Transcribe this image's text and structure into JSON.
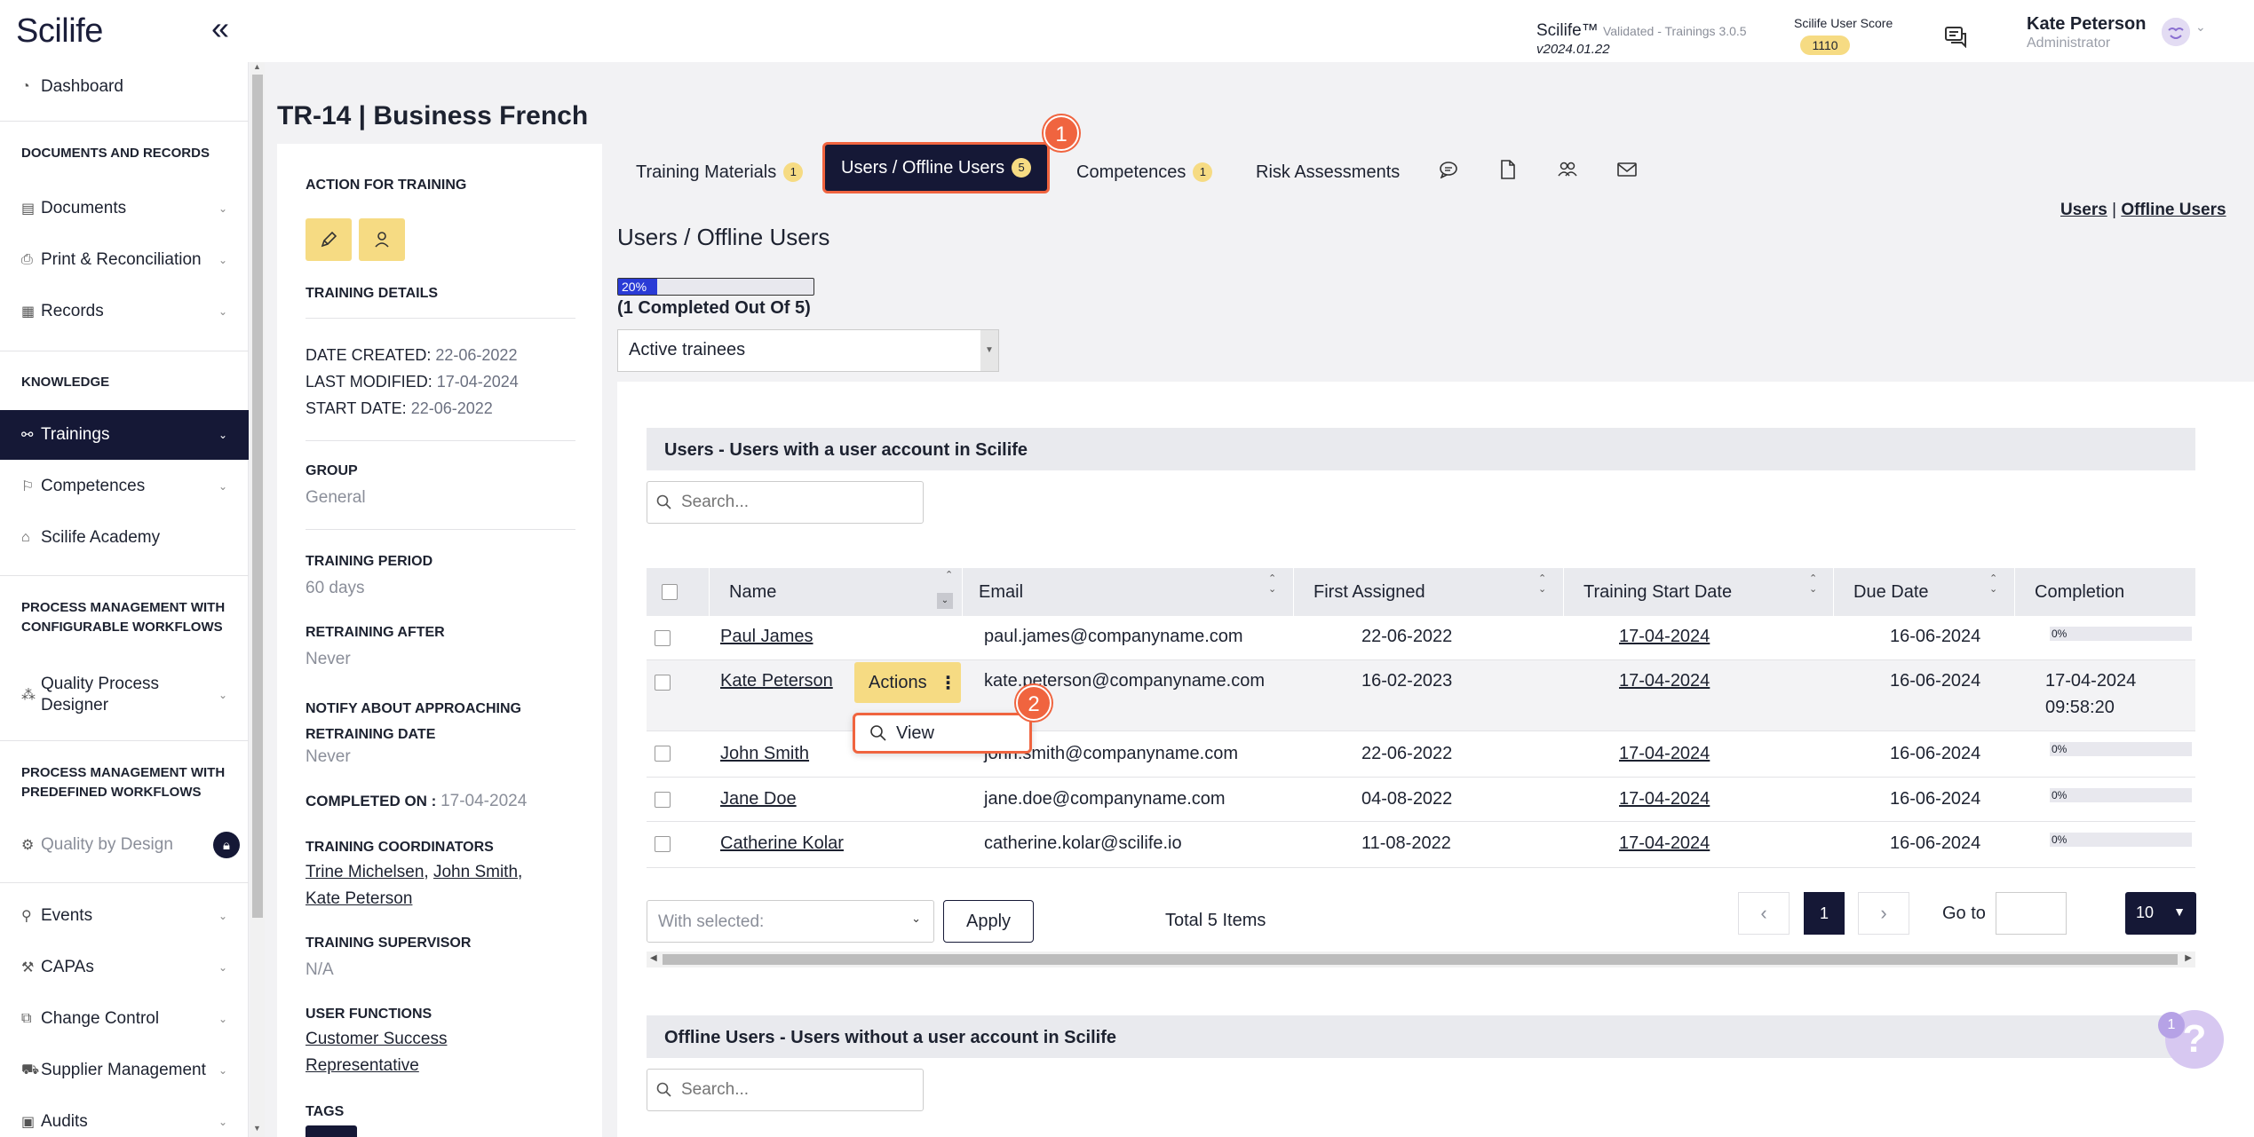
{
  "header": {
    "logo": "Scilife",
    "product": "Scilife™",
    "product_note": "Validated - Trainings 3.0.5",
    "version": "v2024.01.22",
    "score_label": "Scilife User Score",
    "score": "1110",
    "user_name": "Kate Peterson",
    "user_role": "Administrator"
  },
  "sidebar": {
    "dashboard": "Dashboard",
    "sec_docs": "DOCUMENTS AND RECORDS",
    "documents": "Documents",
    "print": "Print & Reconciliation",
    "records": "Records",
    "sec_knowledge": "KNOWLEDGE",
    "trainings": "Trainings",
    "competences": "Competences",
    "academy": "Scilife Academy",
    "sec_pm_conf": "PROCESS MANAGEMENT WITH CONFIGURABLE WORKFLOWS",
    "qpd": "Quality Process Designer",
    "sec_pm_pre": "PROCESS MANAGEMENT WITH PREDEFINED WORKFLOWS",
    "qbd": "Quality by Design",
    "events": "Events",
    "capas": "CAPAs",
    "change": "Change Control",
    "supplier": "Supplier Management",
    "audits": "Audits"
  },
  "page": {
    "title": "TR-14 | Business French"
  },
  "info": {
    "action_label": "ACTION FOR TRAINING",
    "details_label": "TRAINING DETAILS",
    "date_created_label": "DATE CREATED:",
    "date_created": "22-06-2022",
    "last_modified_label": "LAST MODIFIED:",
    "last_modified": "17-04-2024",
    "start_date_label": "START DATE:",
    "start_date": "22-06-2022",
    "group_label": "GROUP",
    "group": "General",
    "period_label": "TRAINING PERIOD",
    "period": "60 days",
    "retraining_label": "RETRAINING AFTER",
    "retraining": "Never",
    "notify_label": "NOTIFY ABOUT APPROACHING RETRAINING DATE",
    "notify": "Never",
    "completed_label": "COMPLETED ON :",
    "completed": "17-04-2024",
    "coord_label": "TRAINING COORDINATORS",
    "coord_1": "Trine Michelsen",
    "coord_2": "John Smith",
    "coord_3": "Kate Peterson",
    "supervisor_label": "TRAINING SUPERVISOR",
    "supervisor": "N/A",
    "functions_label": "USER FUNCTIONS",
    "function_1a": "Customer Success",
    "function_1b": "Representative",
    "tags_label": "TAGS"
  },
  "tabs": {
    "materials": "Training Materials",
    "materials_count": "1",
    "users": "Users / Offline Users",
    "users_count": "5",
    "competences": "Competences",
    "competences_count": "1",
    "risk": "Risk Assessments"
  },
  "markers": {
    "one": "1",
    "two": "2"
  },
  "users_section": {
    "title": "Users / Offline Users",
    "link_users": "Users",
    "link_sep": "|",
    "link_offline": "Offline Users",
    "progress_label": "20%",
    "progress_value": 0.2,
    "progress_text": "(1 Completed Out Of 5)",
    "filter": "Active trainees",
    "band_users": "Users - Users with a user account in Scilife",
    "band_offline": "Offline Users - Users without a user account in Scilife",
    "search_placeholder": "Search..."
  },
  "table": {
    "headers": {
      "name": "Name",
      "email": "Email",
      "first_assigned": "First Assigned",
      "start": "Training Start Date",
      "due": "Due Date",
      "completion": "Completion"
    },
    "rows": [
      {
        "name": "Paul James",
        "email": "paul.james@companyname.com",
        "first": "22-06-2022",
        "start": "17-04-2024",
        "due": "16-06-2024",
        "completion": "0%"
      },
      {
        "name": "Kate Peterson",
        "email": "kate.peterson@companyname.com",
        "first": "16-02-2023",
        "start": "17-04-2024",
        "due": "16-06-2024",
        "completion": "17-04-2024",
        "completion_time": "09:58:20"
      },
      {
        "name": "John Smith",
        "email": "john.smith@companyname.com",
        "first": "22-06-2022",
        "start": "17-04-2024",
        "due": "16-06-2024",
        "completion": "0%"
      },
      {
        "name": "Jane Doe",
        "email": "jane.doe@companyname.com",
        "first": "04-08-2022",
        "start": "17-04-2024",
        "due": "16-06-2024",
        "completion": "0%"
      },
      {
        "name": "Catherine Kolar",
        "email": "catherine.kolar@scilife.io",
        "first": "11-08-2022",
        "start": "17-04-2024",
        "due": "16-06-2024",
        "completion": "0%"
      }
    ],
    "actions": "Actions",
    "view": "View"
  },
  "footer": {
    "with_selected": "With selected:",
    "apply": "Apply",
    "total": "Total 5 Items",
    "page": "1",
    "goto": "Go to",
    "per_page": "10"
  },
  "help": {
    "badge": "1",
    "symbol": "?"
  },
  "colors": {
    "navy": "#151836",
    "accent_yellow": "#f6db83",
    "highlight_orange": "#f0643f",
    "progress_blue": "#2a3bd6"
  }
}
